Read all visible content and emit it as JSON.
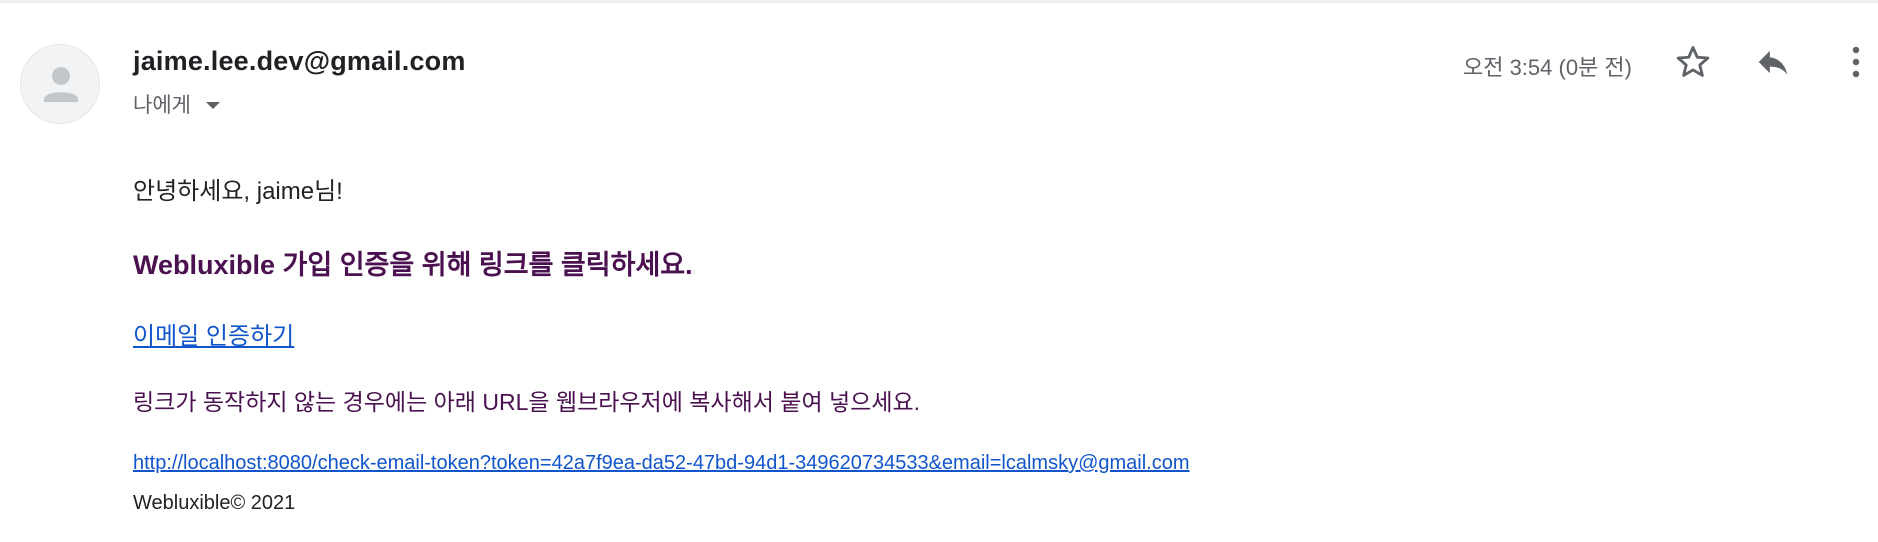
{
  "header": {
    "sender_email": "jaime.lee.dev@gmail.com",
    "recipient_label": "나에게",
    "timestamp": "오전 3:54 (0분 전)",
    "icons": {
      "avatar": "person-avatar-icon",
      "recipient_toggle": "caret-down-icon",
      "star": "star-icon",
      "reply": "reply-icon",
      "more": "more-vert-icon"
    }
  },
  "message": {
    "greeting": "안녕하세요, jaime님!",
    "headline": "Webluxible 가입 인증을 위해 링크를 클릭하세요.",
    "verify_link_text": "이메일 인증하기",
    "instruction": "링크가 동작하지 않는 경우에는 아래 URL을 웹브라우저에 복사해서 붙여 넣으세요.",
    "url": "http://localhost:8080/check-email-token?token=42a7f9ea-da52-47bd-94d1-349620734533&email=lcalmsky@gmail.com",
    "footer": "Webluxible© 2021"
  },
  "colors": {
    "headline": "#4a1050",
    "link": "#1155cc",
    "muted": "#5f6368",
    "text": "#222222"
  }
}
